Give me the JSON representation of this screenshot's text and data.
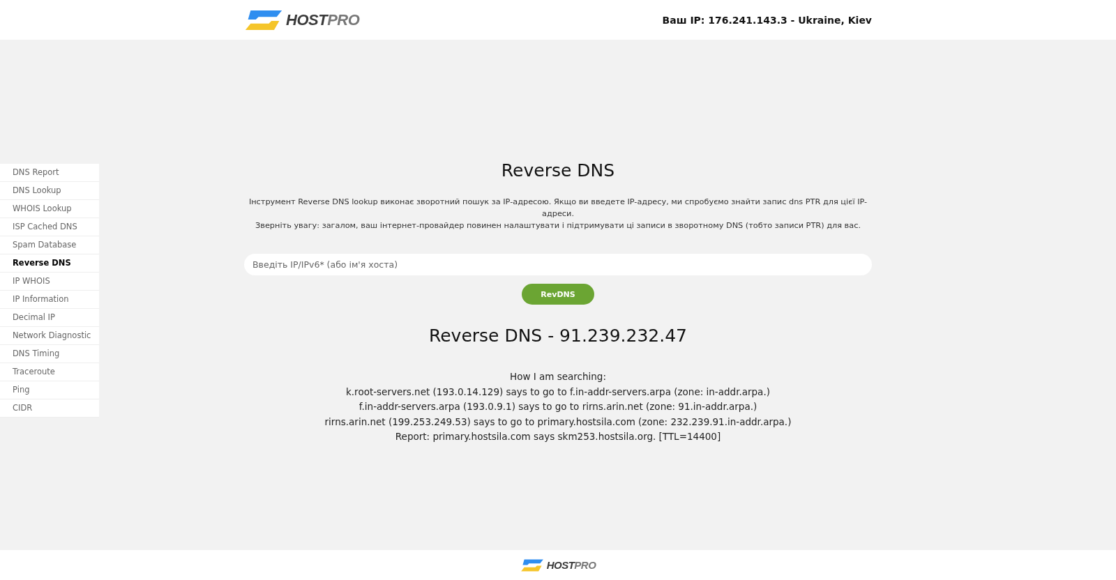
{
  "header": {
    "logo": {
      "part_1": "HOST",
      "part_2": "PRO"
    },
    "ip_info": "Ваш IP: 176.241.143.3 - Ukraine, Kiev"
  },
  "sidebar": {
    "items": [
      {
        "label": "DNS Report",
        "selected": false
      },
      {
        "label": "DNS Lookup",
        "selected": false
      },
      {
        "label": "WHOIS Lookup",
        "selected": false
      },
      {
        "label": "ISP Cached DNS",
        "selected": false
      },
      {
        "label": "Spam Database",
        "selected": false
      },
      {
        "label": "Reverse DNS",
        "selected": true
      },
      {
        "label": "IP WHOIS",
        "selected": false
      },
      {
        "label": "IP Information",
        "selected": false
      },
      {
        "label": "Decimal IP",
        "selected": false
      },
      {
        "label": "Network Diagnostic",
        "selected": false
      },
      {
        "label": "DNS Timing",
        "selected": false
      },
      {
        "label": "Traceroute",
        "selected": false
      },
      {
        "label": "Ping",
        "selected": false
      },
      {
        "label": "CIDR",
        "selected": false
      }
    ]
  },
  "main": {
    "title": "Reverse DNS",
    "description": [
      "Інструмент Reverse DNS lookup виконає зворотний пошук за IP-адресою. Якщо ви введете IP-адресу, ми спробуємо знайти запис dns PTR для цієї IP-адреси.",
      "Зверніть увагу: загалом, ваш інтернет-провайдер повинен налаштувати і підтримувати ці записи в зворотному DNS (тобто записи PTR) для вас."
    ],
    "search": {
      "placeholder": "Введіть IP/IPv6* (або ім'я хоста)"
    },
    "button": "RevDNS",
    "result_title": "Reverse DNS - 91.239.232.47",
    "result_lines": [
      "How I am searching:",
      "k.root-servers.net (193.0.14.129) says to go to f.in-addr-servers.arpa (zone: in-addr.arpa.)",
      "f.in-addr-servers.arpa (193.0.9.1) says to go to rirns.arin.net (zone: 91.in-addr.arpa.)",
      "rirns.arin.net (199.253.249.53) says to go to primary.hostsila.com (zone: 232.239.91.in-addr.arpa.)",
      "Report: primary.hostsila.com says skm253.hostsila.org. [TTL=14400]"
    ]
  },
  "footer": {
    "logo": {
      "part_1": "HOST",
      "part_2": "PRO"
    }
  }
}
